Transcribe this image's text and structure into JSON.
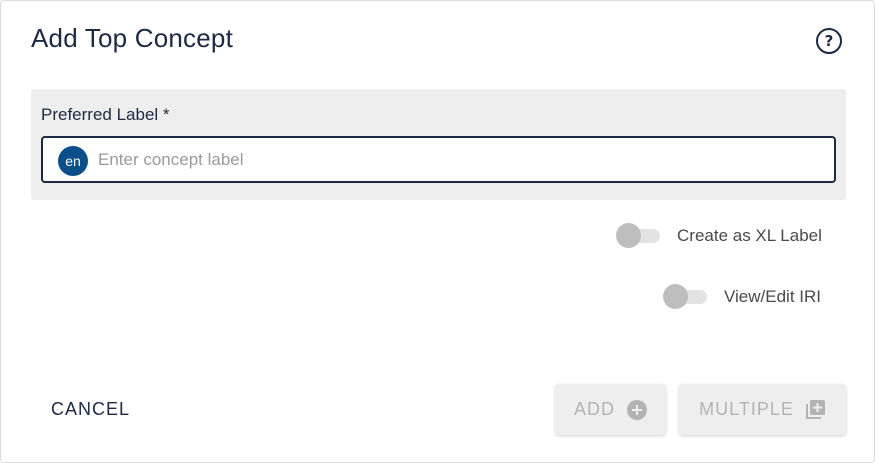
{
  "dialog": {
    "title": "Add Top Concept",
    "help_icon": "help-circle-icon",
    "help_glyph": "?"
  },
  "preferred_label": {
    "label": "Preferred Label *",
    "language": "en",
    "value": "",
    "placeholder": "Enter concept label"
  },
  "toggles": {
    "xl_label": {
      "label": "Create as XL Label",
      "checked": false
    },
    "view_edit_iri": {
      "label": "View/Edit IRI",
      "checked": false
    }
  },
  "actions": {
    "cancel_label": "CANCEL",
    "add_label": "ADD",
    "add_icon": "plus-circle-icon",
    "multiple_label": "MULTIPLE",
    "multiple_icon": "library-add-icon"
  },
  "colors": {
    "primary": "#1c2a44",
    "badge": "#0b4f8a",
    "panel": "#eeeeee",
    "disabled_text": "#b3b3b3"
  }
}
